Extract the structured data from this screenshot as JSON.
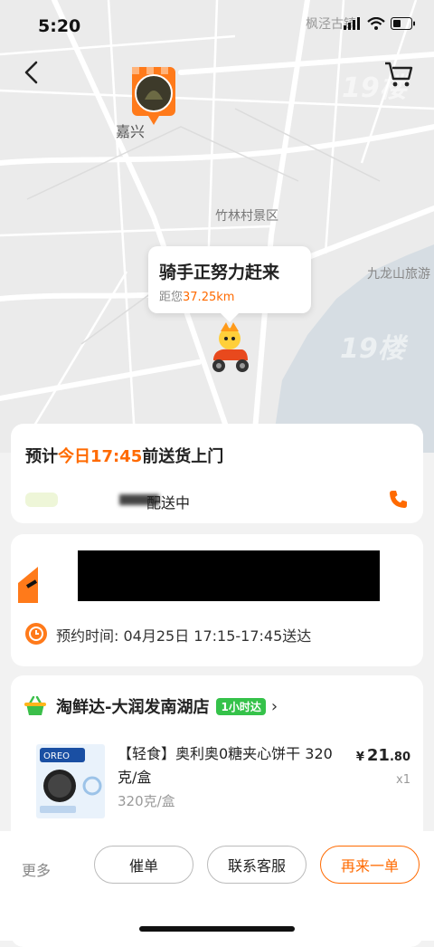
{
  "status_bar": {
    "time": "5:20",
    "place": "枫泾古镇"
  },
  "map": {
    "labels": {
      "jiaxing": "嘉兴",
      "zhulin": "竹林村景区",
      "jiulong": "九龙山旅游"
    },
    "bubble": {
      "title": "骑手正努力赶来",
      "distance_prefix": "距您",
      "distance_value": "37.25km"
    },
    "watermark": "19楼"
  },
  "delivery_card": {
    "eta_prefix": "预计",
    "eta_highlight": "今日17:45",
    "eta_suffix": "前送货上门",
    "status_text": "配送中"
  },
  "schedule_card": {
    "schedule_text": "预约时间: 04月25日 17:15-17:45送达"
  },
  "store_card": {
    "store_name": "淘鲜达-大润发南湖店",
    "badge": "1小时达",
    "product": {
      "title": "【轻食】奥利奥0糖夹心饼干 320克/盒",
      "spec": "320克/盒",
      "price_symbol": "¥",
      "price_int": "21",
      "price_dec": ".80",
      "qty": "x1"
    }
  },
  "bottom_bar": {
    "more": "更多",
    "urge": "催单",
    "customer_service": "联系客服",
    "reorder": "再来一单"
  },
  "colors": {
    "accent": "#ff6a00",
    "badge_green": "#35c24a"
  }
}
